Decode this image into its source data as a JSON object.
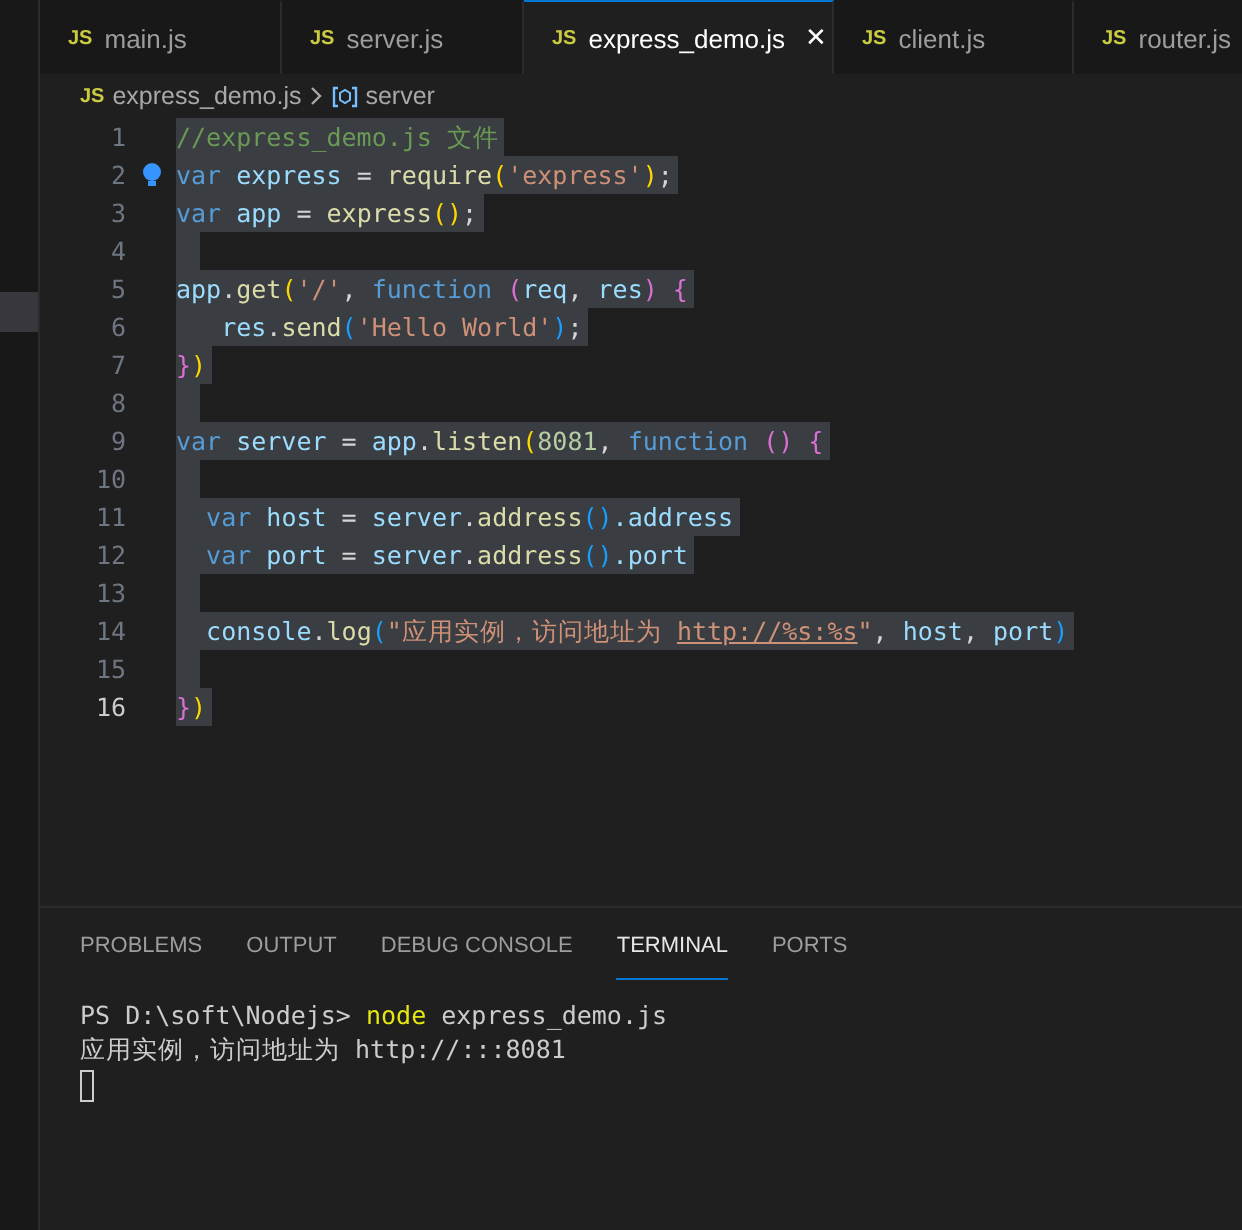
{
  "tabs": [
    {
      "badge": "JS",
      "label": "main.js",
      "selected": false
    },
    {
      "badge": "JS",
      "label": "server.js",
      "selected": false
    },
    {
      "badge": "JS",
      "label": "express_demo.js",
      "selected": true,
      "close": "✕"
    },
    {
      "badge": "JS",
      "label": "client.js",
      "selected": false
    },
    {
      "badge": "JS",
      "label": "router.js",
      "selected": false
    }
  ],
  "breadcrumbs": {
    "badge": "JS",
    "file": "express_demo.js",
    "symbol": "server"
  },
  "editor": {
    "lines": [
      {
        "number": "1",
        "active": false,
        "tokens": [
          {
            "text": "//express_demo.js 文件",
            "kind": "comment"
          }
        ]
      },
      {
        "number": "2",
        "active": false,
        "tokens": [
          {
            "text": "var",
            "kind": "keyword"
          },
          {
            "text": " express ",
            "kind": "variable"
          },
          {
            "text": "= ",
            "kind": "punct"
          },
          {
            "text": "require",
            "kind": "call"
          },
          {
            "text": "(",
            "kind": "bracket1"
          },
          {
            "text": "'express'",
            "kind": "string"
          },
          {
            "text": ")",
            "kind": "bracket1"
          },
          {
            "text": ";",
            "kind": "punct"
          }
        ]
      },
      {
        "number": "3",
        "active": false,
        "tokens": [
          {
            "text": "var",
            "kind": "keyword"
          },
          {
            "text": " app ",
            "kind": "variable"
          },
          {
            "text": "= ",
            "kind": "punct"
          },
          {
            "text": "express",
            "kind": "call"
          },
          {
            "text": "()",
            "kind": "bracket1"
          },
          {
            "text": ";",
            "kind": "punct"
          }
        ]
      },
      {
        "number": "4",
        "active": false
      },
      {
        "number": "5",
        "active": false,
        "tokens": [
          {
            "text": "app",
            "kind": "variable"
          },
          {
            "text": ".",
            "kind": "punct"
          },
          {
            "text": "get",
            "kind": "call"
          },
          {
            "text": "(",
            "kind": "bracket1"
          },
          {
            "text": "'/'",
            "kind": "string"
          },
          {
            "text": ", ",
            "kind": "punct"
          },
          {
            "text": "function ",
            "kind": "keyword"
          },
          {
            "text": "(",
            "kind": "bracket2"
          },
          {
            "text": "req",
            "kind": "variable"
          },
          {
            "text": ", ",
            "kind": "punct"
          },
          {
            "text": "res",
            "kind": "variable"
          },
          {
            "text": ") {",
            "kind": "bracket2"
          }
        ]
      },
      {
        "number": "6",
        "active": false,
        "tokens": [
          {
            "text": "   res",
            "kind": "variable"
          },
          {
            "text": ".",
            "kind": "punct"
          },
          {
            "text": "send",
            "kind": "call"
          },
          {
            "text": "(",
            "kind": "bracket3"
          },
          {
            "text": "'Hello World'",
            "kind": "string"
          },
          {
            "text": ")",
            "kind": "bracket3"
          },
          {
            "text": ";",
            "kind": "punct"
          }
        ]
      },
      {
        "number": "7",
        "active": false,
        "tokens": [
          {
            "text": "}",
            "kind": "bracket2"
          },
          {
            "text": ")",
            "kind": "bracket1"
          }
        ]
      },
      {
        "number": "8",
        "active": false
      },
      {
        "number": "9",
        "active": false,
        "tokens": [
          {
            "text": "var",
            "kind": "keyword"
          },
          {
            "text": " server ",
            "kind": "variable"
          },
          {
            "text": "= ",
            "kind": "punct"
          },
          {
            "text": "app",
            "kind": "variable"
          },
          {
            "text": ".",
            "kind": "punct"
          },
          {
            "text": "listen",
            "kind": "call"
          },
          {
            "text": "(",
            "kind": "bracket1"
          },
          {
            "text": "8081",
            "kind": "number"
          },
          {
            "text": ", ",
            "kind": "punct"
          },
          {
            "text": "function ",
            "kind": "keyword"
          },
          {
            "text": "() {",
            "kind": "bracket2"
          }
        ]
      },
      {
        "number": "10",
        "active": false
      },
      {
        "number": "11",
        "active": false,
        "tokens": [
          {
            "text": "  var",
            "kind": "keyword"
          },
          {
            "text": " host ",
            "kind": "variable"
          },
          {
            "text": "= ",
            "kind": "punct"
          },
          {
            "text": "server",
            "kind": "variable"
          },
          {
            "text": ".",
            "kind": "punct"
          },
          {
            "text": "address",
            "kind": "call"
          },
          {
            "text": "()",
            "kind": "bracket3"
          },
          {
            "text": ".address",
            "kind": "variable"
          }
        ]
      },
      {
        "number": "12",
        "active": false,
        "tokens": [
          {
            "text": "  var",
            "kind": "keyword"
          },
          {
            "text": " port ",
            "kind": "variable"
          },
          {
            "text": "= ",
            "kind": "punct"
          },
          {
            "text": "server",
            "kind": "variable"
          },
          {
            "text": ".",
            "kind": "punct"
          },
          {
            "text": "address",
            "kind": "call"
          },
          {
            "text": "()",
            "kind": "bracket3"
          },
          {
            "text": ".port",
            "kind": "variable"
          }
        ]
      },
      {
        "number": "13",
        "active": false
      },
      {
        "number": "14",
        "active": false,
        "tokens": [
          {
            "text": "  console",
            "kind": "variable"
          },
          {
            "text": ".",
            "kind": "punct"
          },
          {
            "text": "log",
            "kind": "call"
          },
          {
            "text": "(",
            "kind": "bracket3"
          },
          {
            "text": "\"应用实例，访问地址为 ",
            "kind": "string"
          },
          {
            "text": "http://%s:%s",
            "kind": "link"
          },
          {
            "text": "\"",
            "kind": "string"
          },
          {
            "text": ", ",
            "kind": "punct"
          },
          {
            "text": "host",
            "kind": "variable"
          },
          {
            "text": ", ",
            "kind": "punct"
          },
          {
            "text": "port",
            "kind": "variable"
          },
          {
            "text": ")",
            "kind": "bracket3"
          }
        ]
      },
      {
        "number": "15",
        "active": false
      },
      {
        "number": "16",
        "active": true,
        "tokens": [
          {
            "text": "}",
            "kind": "bracket2"
          },
          {
            "text": ")",
            "kind": "bracket1"
          }
        ]
      }
    ]
  },
  "panel": {
    "tabs": [
      {
        "label": "PROBLEMS",
        "selected": false
      },
      {
        "label": "OUTPUT",
        "selected": false
      },
      {
        "label": "DEBUG CONSOLE",
        "selected": false
      },
      {
        "label": "TERMINAL",
        "selected": true
      },
      {
        "label": "PORTS",
        "selected": false
      }
    ],
    "terminal": {
      "prompt": "PS D:\\soft\\Nodejs> ",
      "command": "node",
      "arguments": " express_demo.js",
      "output": "应用实例，访问地址为 http://:::8081"
    }
  }
}
